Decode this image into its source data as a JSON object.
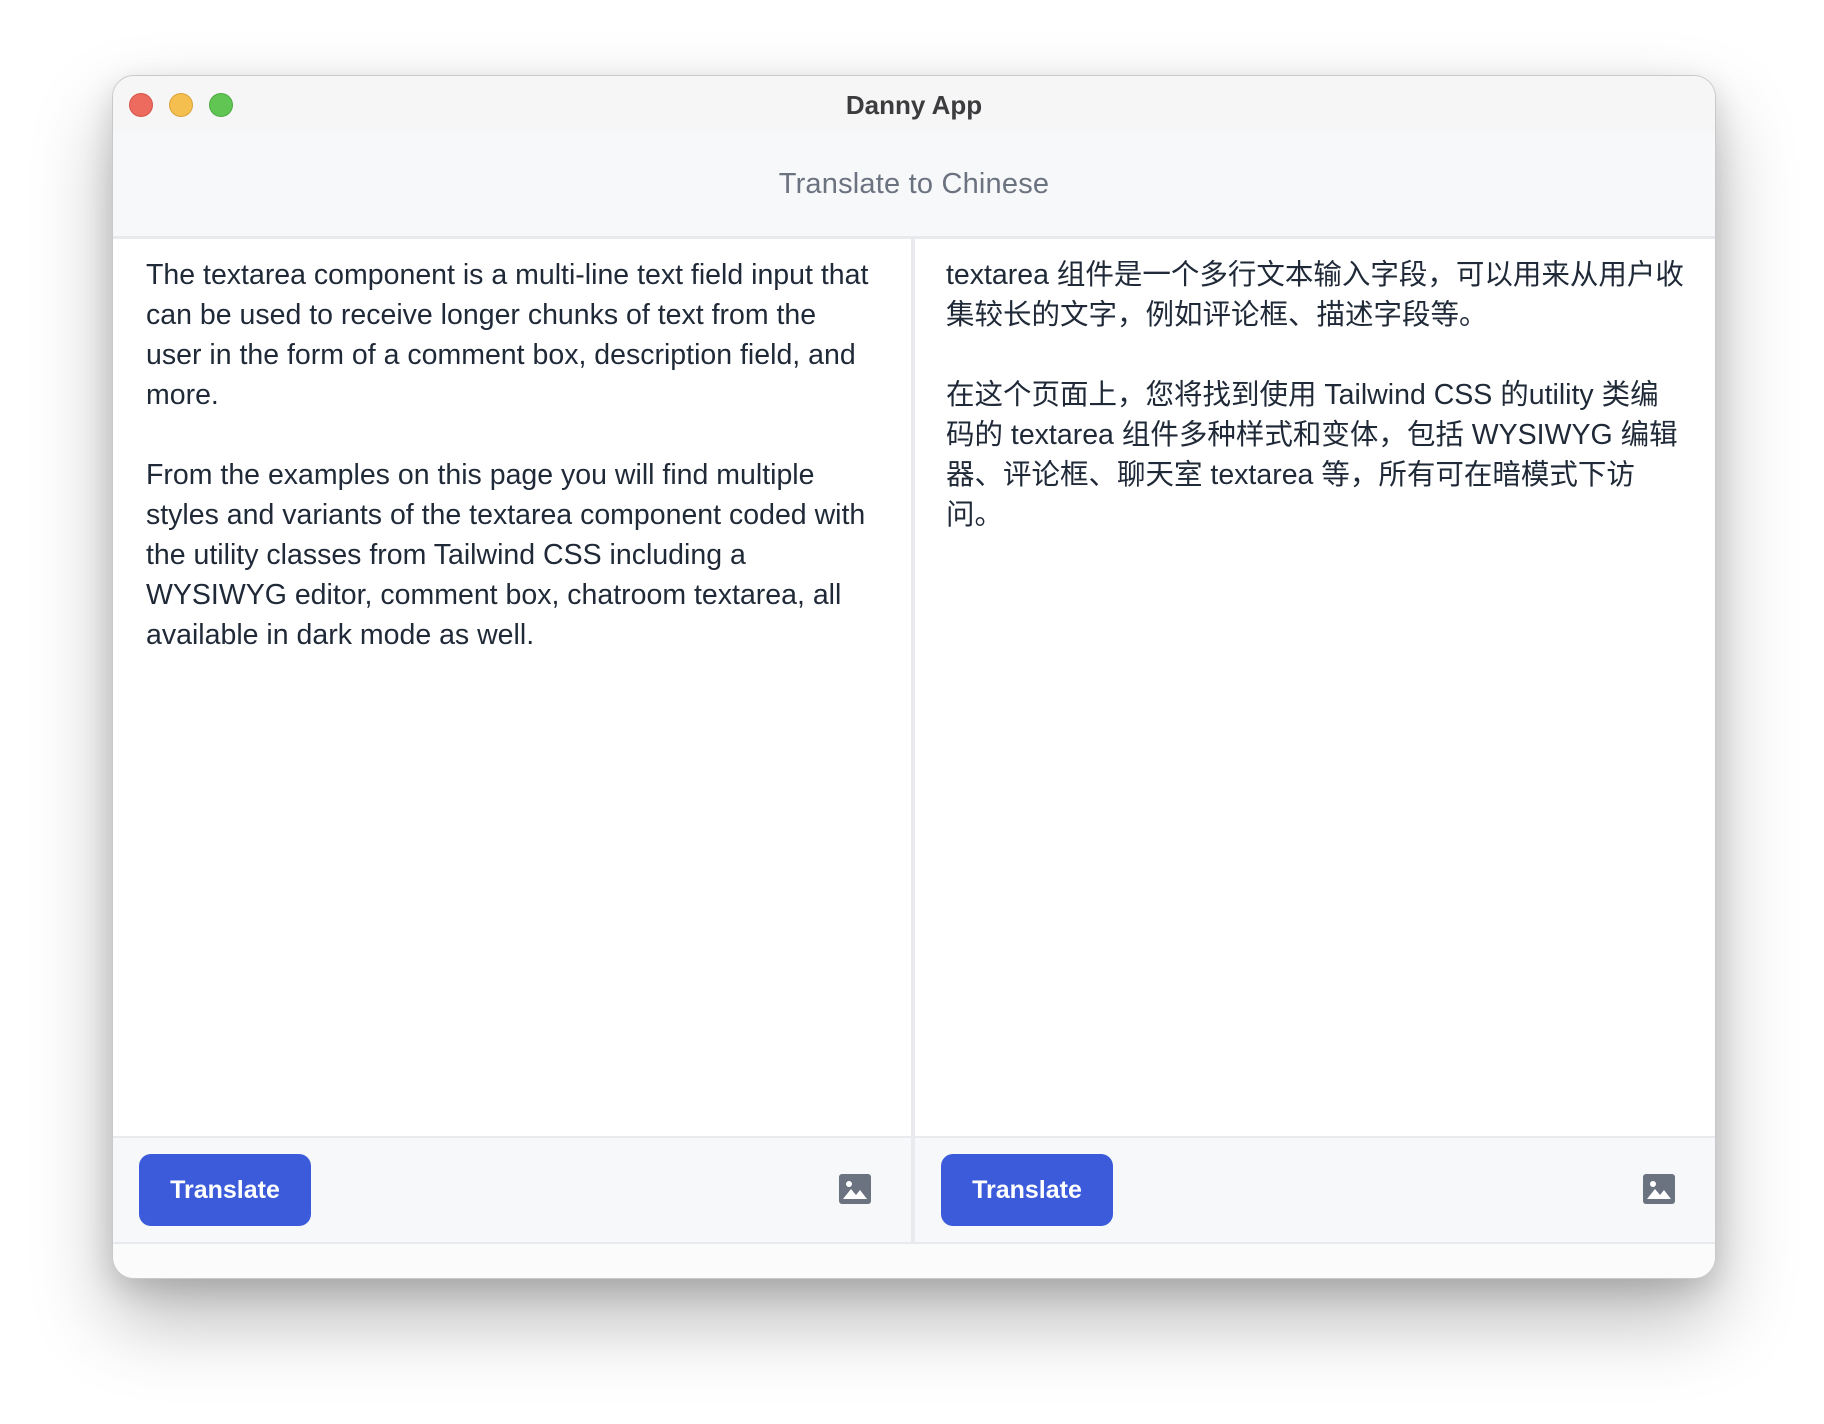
{
  "window": {
    "title": "Danny App"
  },
  "header": {
    "title": "Translate to Chinese"
  },
  "panes": [
    {
      "text": "The textarea component is a multi-line text field input that can be used to receive longer chunks of text from the user in the form of a comment box, description field, and more.\n\nFrom the examples on this page you will find multiple styles and variants of the textarea component coded with the utility classes from Tailwind CSS including a WYSIWYG editor, comment box, chatroom textarea, all available in dark mode as well.",
      "button_label": "Translate",
      "icon": "image-icon"
    },
    {
      "text": "textarea 组件是一个多行文本输入字段，可以用来从用户收集较长的文字，例如评论框、描述字段等。\n\n在这个页面上，您将找到使用 Tailwind CSS 的utility 类编码的 textarea 组件多种样式和变体，包括 WYSIWYG 编辑器、评论框、聊天室 textarea 等，所有可在暗模式下访问。",
      "button_label": "Translate",
      "icon": "image-icon"
    }
  ],
  "colors": {
    "accent": "#3b5bdb",
    "icon": "#6b7280",
    "text": "#1f2937"
  }
}
